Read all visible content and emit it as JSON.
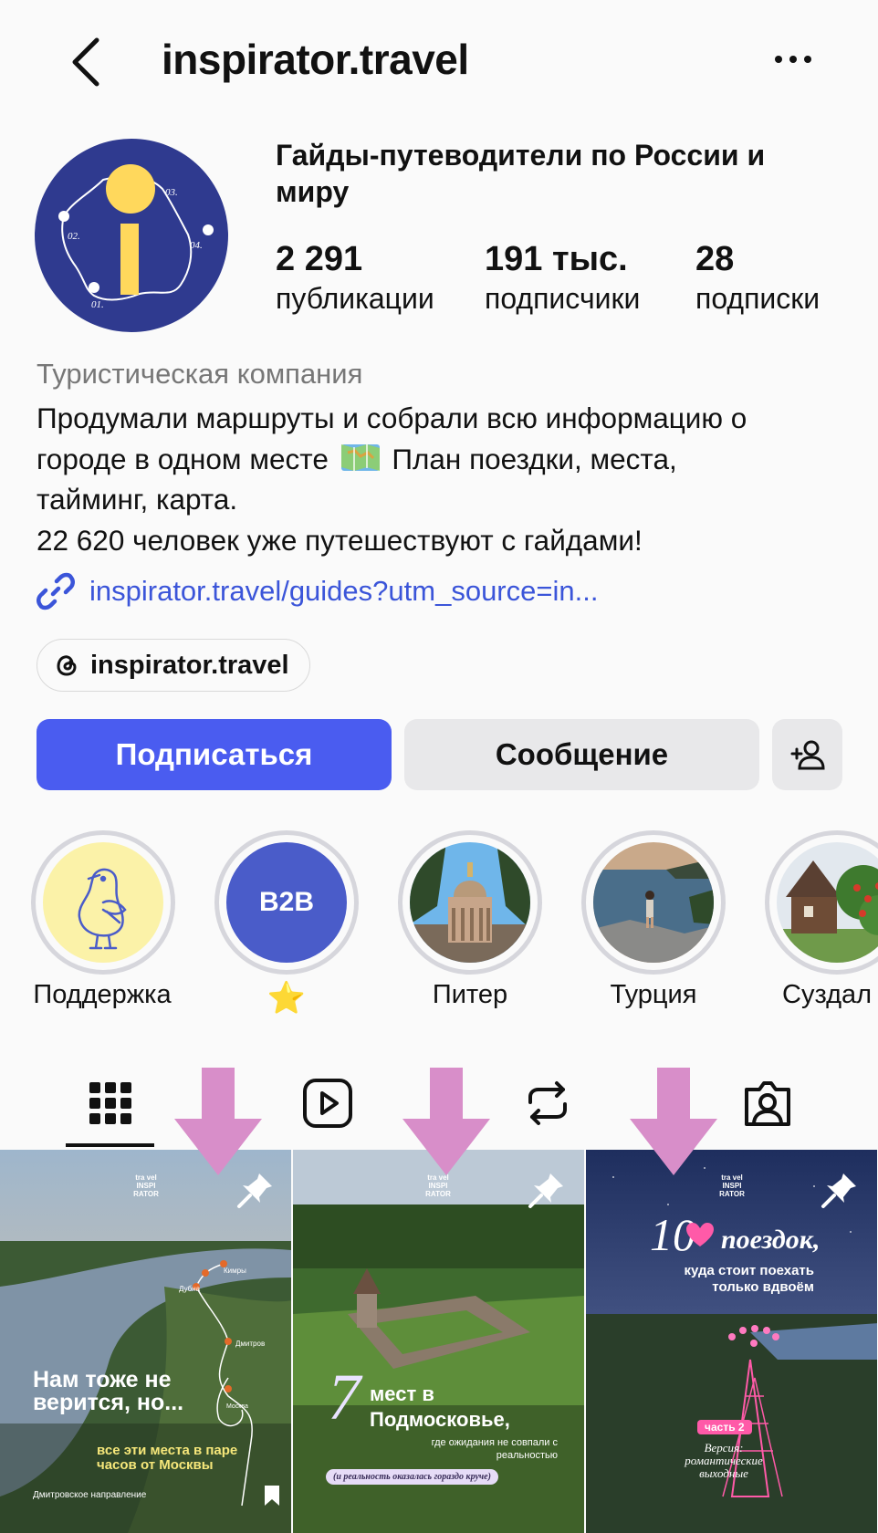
{
  "header": {
    "back_icon": "chevron-left-icon",
    "username": "inspirator.travel",
    "more_icon": "more-horizontal-icon"
  },
  "profile": {
    "avatar_icon": "inspirator-logo",
    "avatar_labels": [
      "01.",
      "02.",
      "03.",
      "04."
    ],
    "name": "Гайды-путеводители по России и миру",
    "stats": [
      {
        "value": "2 291",
        "label": "публикации"
      },
      {
        "value": "191 тыс.",
        "label": "подписчики"
      },
      {
        "value": "28",
        "label": "подписки"
      }
    ],
    "category": "Туристическая компания",
    "bio_line1": "Продумали маршруты и собрали всю информацию о",
    "bio_line2_a": "городе в одном месте",
    "bio_line2_b": "План поездки, места,",
    "bio_line3": "тайминг, карта.",
    "bio_line4": "22 620 человек уже путешествуют с гайдами!",
    "link": "inspirator.travel/guides?utm_source=in...",
    "threads_handle": "inspirator.travel"
  },
  "actions": {
    "follow": "Подписаться",
    "message": "Сообщение",
    "add_user_icon": "add-user-icon",
    "follow_color": "#4a5cf0"
  },
  "highlights": [
    {
      "label": "Поддержка",
      "icon": "seagull-illustration"
    },
    {
      "label": "⭐",
      "icon": "b2b-badge",
      "text": "B2B"
    },
    {
      "label": "Питер",
      "icon": "cathedral-photo"
    },
    {
      "label": "Турция",
      "icon": "sea-photo"
    },
    {
      "label": "Суздал",
      "icon": "wooden-house-photo"
    }
  ],
  "tabs": [
    "grid-icon",
    "reels-icon",
    "reposts-icon",
    "tagged-icon"
  ],
  "posts": [
    {
      "brand": "tra vel INSPI RATOR",
      "headline": "Нам тоже не верится, но...",
      "highlight": "все эти места в паре часов от Москвы",
      "footer": "Дмитровское направление",
      "map_labels": [
        "Кимры",
        "Дубна",
        "Дмитров",
        "Москва"
      ]
    },
    {
      "brand": "tra vel INSPI RATOR",
      "number": "7",
      "headline": "мест в Подмосковье,",
      "sub": "где ожидания не совпали с реальностью",
      "pill": "(и реальность оказалась гораздо круче)"
    },
    {
      "brand": "tra vel INSPI RATOR",
      "number": "10",
      "headline": "поездок,",
      "sub": "куда стоит поехать только вдвоём",
      "part": "часть 2",
      "version": "Версия: романтические выходные"
    }
  ]
}
